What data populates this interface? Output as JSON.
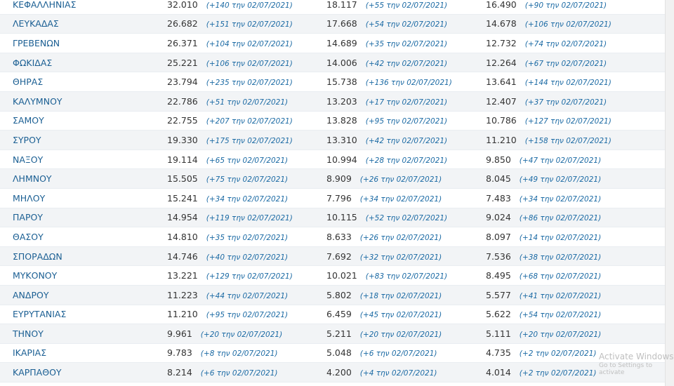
{
  "rows": [
    {
      "name": "ΚΕΦΑΛΛΗΝΙΑΣ",
      "v1": "32.010",
      "d1": "(+140 την 02/07/2021)",
      "v2": "18.117",
      "d2": "(+55 την 02/07/2021)",
      "v3": "16.490",
      "d3": "(+90 την 02/07/2021)"
    },
    {
      "name": "ΛΕΥΚΑΔΑΣ",
      "v1": "26.682",
      "d1": "(+151 την 02/07/2021)",
      "v2": "17.668",
      "d2": "(+54 την 02/07/2021)",
      "v3": "14.678",
      "d3": "(+106 την 02/07/2021)"
    },
    {
      "name": "ΓΡΕΒΕΝΩΝ",
      "v1": "26.371",
      "d1": "(+104 την 02/07/2021)",
      "v2": "14.689",
      "d2": "(+35 την 02/07/2021)",
      "v3": "12.732",
      "d3": "(+74 την 02/07/2021)"
    },
    {
      "name": "ΦΩΚΙΔΑΣ",
      "v1": "25.221",
      "d1": "(+106 την 02/07/2021)",
      "v2": "14.006",
      "d2": "(+42 την 02/07/2021)",
      "v3": "12.264",
      "d3": "(+67 την 02/07/2021)"
    },
    {
      "name": "ΘΗΡΑΣ",
      "v1": "23.794",
      "d1": "(+235 την 02/07/2021)",
      "v2": "15.738",
      "d2": "(+136 την 02/07/2021)",
      "v3": "13.641",
      "d3": "(+144 την 02/07/2021)"
    },
    {
      "name": "ΚΑΛΥΜΝΟΥ",
      "v1": "22.786",
      "d1": "(+51 την 02/07/2021)",
      "v2": "13.203",
      "d2": "(+17 την 02/07/2021)",
      "v3": "12.407",
      "d3": "(+37 την 02/07/2021)"
    },
    {
      "name": "ΣΑΜΟΥ",
      "v1": "22.755",
      "d1": "(+207 την 02/07/2021)",
      "v2": "13.828",
      "d2": "(+95 την 02/07/2021)",
      "v3": "10.786",
      "d3": "(+127 την 02/07/2021)"
    },
    {
      "name": "ΣΥΡΟΥ",
      "v1": "19.330",
      "d1": "(+175 την 02/07/2021)",
      "v2": "13.310",
      "d2": "(+42 την 02/07/2021)",
      "v3": "11.210",
      "d3": "(+158 την 02/07/2021)"
    },
    {
      "name": "ΝΑΞΟΥ",
      "v1": "19.114",
      "d1": "(+65 την 02/07/2021)",
      "v2": "10.994",
      "d2": "(+28 την 02/07/2021)",
      "v3": "9.850",
      "d3": "(+47 την 02/07/2021)"
    },
    {
      "name": "ΛΗΜΝΟΥ",
      "v1": "15.505",
      "d1": "(+75 την 02/07/2021)",
      "v2": "8.909",
      "d2": "(+26 την 02/07/2021)",
      "v3": "8.045",
      "d3": "(+49 την 02/07/2021)"
    },
    {
      "name": "ΜΗΛΟΥ",
      "v1": "15.241",
      "d1": "(+34 την 02/07/2021)",
      "v2": "7.796",
      "d2": "(+34 την 02/07/2021)",
      "v3": "7.483",
      "d3": "(+34 την 02/07/2021)"
    },
    {
      "name": "ΠΑΡΟΥ",
      "v1": "14.954",
      "d1": "(+119 την 02/07/2021)",
      "v2": "10.115",
      "d2": "(+52 την 02/07/2021)",
      "v3": "9.024",
      "d3": "(+86 την 02/07/2021)"
    },
    {
      "name": "ΘΑΣΟΥ",
      "v1": "14.810",
      "d1": "(+35 την 02/07/2021)",
      "v2": "8.633",
      "d2": "(+26 την 02/07/2021)",
      "v3": "8.097",
      "d3": "(+14 την 02/07/2021)"
    },
    {
      "name": "ΣΠΟΡΑΔΩΝ",
      "v1": "14.746",
      "d1": "(+40 την 02/07/2021)",
      "v2": "7.692",
      "d2": "(+32 την 02/07/2021)",
      "v3": "7.536",
      "d3": "(+38 την 02/07/2021)"
    },
    {
      "name": "ΜΥΚΟΝΟΥ",
      "v1": "13.221",
      "d1": "(+129 την 02/07/2021)",
      "v2": "10.021",
      "d2": "(+83 την 02/07/2021)",
      "v3": "8.495",
      "d3": "(+68 την 02/07/2021)"
    },
    {
      "name": "ΑΝΔΡΟΥ",
      "v1": "11.223",
      "d1": "(+44 την 02/07/2021)",
      "v2": "5.802",
      "d2": "(+18 την 02/07/2021)",
      "v3": "5.577",
      "d3": "(+41 την 02/07/2021)"
    },
    {
      "name": "ΕΥΡΥΤΑΝΙΑΣ",
      "v1": "11.210",
      "d1": "(+95 την 02/07/2021)",
      "v2": "6.459",
      "d2": "(+45 την 02/07/2021)",
      "v3": "5.622",
      "d3": "(+54 την 02/07/2021)"
    },
    {
      "name": "ΤΗΝΟΥ",
      "v1": "9.961",
      "d1": "(+20 την 02/07/2021)",
      "v2": "5.211",
      "d2": "(+20 την 02/07/2021)",
      "v3": "5.111",
      "d3": "(+20 την 02/07/2021)"
    },
    {
      "name": "ΙΚΑΡΙΑΣ",
      "v1": "9.783",
      "d1": "(+8 την 02/07/2021)",
      "v2": "5.048",
      "d2": "(+6 την 02/07/2021)",
      "v3": "4.735",
      "d3": "(+2 την 02/07/2021)"
    },
    {
      "name": "ΚΑΡΠΑΘΟΥ",
      "v1": "8.214",
      "d1": "(+6 την 02/07/2021)",
      "v2": "4.200",
      "d2": "(+4 την 02/07/2021)",
      "v3": "4.014",
      "d3": "(+2 την 02/07/2021)"
    }
  ],
  "watermark": {
    "title": "Activate Windows",
    "subtitle": "Go to Settings to activate"
  }
}
